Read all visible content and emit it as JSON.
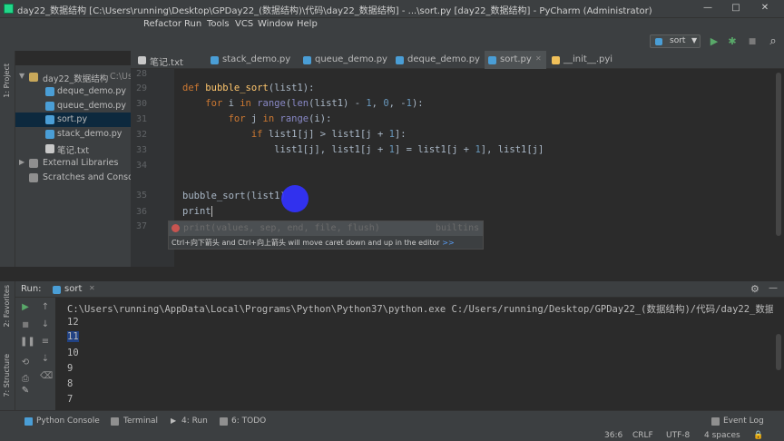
{
  "window": {
    "title": "day22_数据结构 [C:\\Users\\running\\Desktop\\GPDay22_(数据结构)\\代码\\day22_数据结构] - ...\\sort.py [day22_数据结构] - PyCharm (Administrator)",
    "minimize": "—",
    "maximize": "□",
    "close": "✕"
  },
  "menu": [
    "Refactor",
    "Run",
    "Tools",
    "VCS",
    "Window",
    "Help"
  ],
  "toolbar": {
    "run_config": "sort",
    "run_icon": "▶",
    "debug_icon": "✱",
    "stop_icon": "■",
    "search_icon": "⌕"
  },
  "left_strip": {
    "project_tab": "1: Project",
    "favorites_tab": "2: Favorites",
    "structure_tab": "7: Structure"
  },
  "project": {
    "root": "day22_数据结构",
    "root_path": "C:\\Us",
    "files": [
      "deque_demo.py",
      "queue_demo.py",
      "sort.py",
      "stack_demo.py",
      "笔记.txt"
    ],
    "external": "External Libraries",
    "scratches": "Scratches and Consoles"
  },
  "tabs": [
    {
      "label": "笔记.txt",
      "color": "#c8c8c8"
    },
    {
      "label": "stack_demo.py",
      "color": "#4a9ed6"
    },
    {
      "label": "queue_demo.py",
      "color": "#4a9ed6"
    },
    {
      "label": "deque_demo.py",
      "color": "#4a9ed6"
    },
    {
      "label": "sort.py",
      "color": "#4a9ed6",
      "active": true
    },
    {
      "label": "__init__.pyi",
      "color": "#f0c05a"
    }
  ],
  "editor": {
    "line_numbers": [
      "28",
      "29",
      "30",
      "31",
      "32",
      "33",
      "34",
      "35",
      "36",
      "37"
    ],
    "lines": {
      "l28_kw": "def",
      "l28_fn": "bubble_sort",
      "l28_rest": "(list1):",
      "l29_kw": "for",
      "l29_a": " i ",
      "l29_kw2": "in",
      "l29_bi": "range",
      "l29_b": "(",
      "l29_bi2": "len",
      "l29_c": "(list1) - ",
      "l29_n1": "1",
      "l29_d": ", ",
      "l29_n2": "0",
      "l29_e": ", -",
      "l29_n3": "1",
      "l29_f": "):",
      "l30_kw": "for",
      "l30_a": " j ",
      "l30_kw2": "in",
      "l30_bi": "range",
      "l30_b": "(i):",
      "l31_kw": "if",
      "l31_a": " list1[j] > list1[j + ",
      "l31_n": "1",
      "l31_b": "]:",
      "l32_a": "list1[j], list1[j + ",
      "l32_n1": "1",
      "l32_b": "] = list1[j + ",
      "l32_n2": "1",
      "l32_c": "], list1[j]",
      "l35": "bubble_sort(list1)",
      "l36": "print"
    }
  },
  "autocomplete": {
    "signature": "print(values, sep, end, file, flush)",
    "source": "builtins",
    "hint": "Ctrl+向下箭头 and Ctrl+向上箭头 will move caret down and up in the editor",
    "more": ">>"
  },
  "run_panel": {
    "label": "Run:",
    "tab": "sort",
    "tab_close": "✕",
    "settings_icon": "⚙",
    "hide_icon": "—",
    "command": "C:\\Users\\running\\AppData\\Local\\Programs\\Python\\Python37\\python.exe C:/Users/running/Desktop/GPDay22_(数据结构)/代码/day22_数据结构",
    "output": [
      "12",
      "11",
      "10",
      "9",
      "8",
      "7"
    ]
  },
  "status": {
    "python_console": "Python Console",
    "terminal": "Terminal",
    "run": "4: Run",
    "todo": "6: TODO",
    "event_log": "Event Log",
    "position": "36:6",
    "line_sep": "CRLF",
    "encoding": "UTF-8",
    "indent": "4 spaces"
  }
}
